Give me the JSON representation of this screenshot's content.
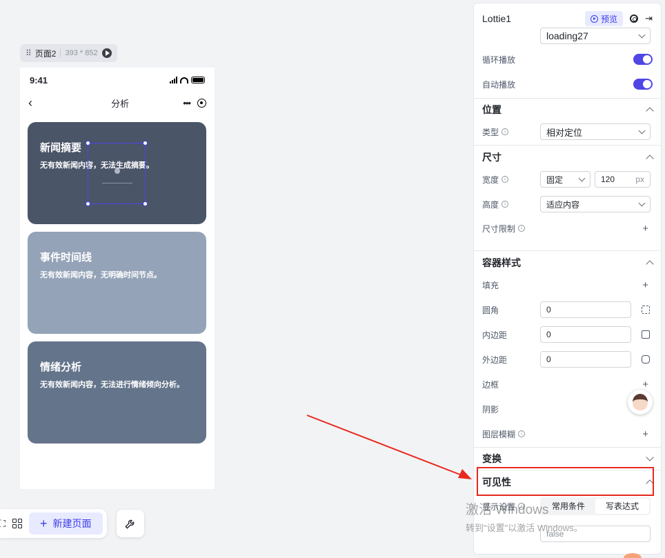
{
  "canvas": {
    "page_tag": {
      "name": "页面2",
      "size": "393 * 852"
    },
    "phone": {
      "time": "9:41",
      "nav_title": "分析",
      "cards": [
        {
          "title": "新闻摘要",
          "desc": "无有效新闻内容，无法生成摘要。"
        },
        {
          "title": "事件时间线",
          "desc": "无有效新闻内容，无明确时间节点。"
        },
        {
          "title": "情绪分析",
          "desc": "无有效新闻内容，无法进行情绪倾向分析。"
        }
      ]
    },
    "bottom_bar": {
      "new_page": "新建页面"
    }
  },
  "panel": {
    "title": "Lottie1",
    "preview": "预览",
    "animation_value": "loading27",
    "loop_label": "循环播放",
    "autoplay_label": "自动播放",
    "position": {
      "header": "位置",
      "type_label": "类型",
      "type_value": "相对定位"
    },
    "size": {
      "header": "尺寸",
      "width_label": "宽度",
      "width_mode": "固定",
      "width_value": "120",
      "width_unit": "px",
      "height_label": "高度",
      "height_mode": "适应内容",
      "limit_label": "尺寸限制"
    },
    "container_style": {
      "header": "容器样式",
      "fill_label": "填充",
      "radius_label": "圆角",
      "radius_value": "0",
      "padding_label": "内边距",
      "padding_value": "0",
      "margin_label": "外边距",
      "margin_value": "0",
      "border_label": "边框",
      "shadow_label": "阴影",
      "blur_label": "图层模糊"
    },
    "transform": {
      "header": "变换"
    },
    "visibility": {
      "header": "可见性",
      "display_label": "显示设置",
      "tab_common": "常用条件",
      "tab_expr": "写表达式",
      "expr_value": "false"
    }
  },
  "watermark": {
    "line1": "激活 Windows",
    "line2": "转到\"设置\"以激活 Windows。"
  },
  "colors": {
    "accent": "#4f46e5",
    "annotation": "#e8271d"
  }
}
